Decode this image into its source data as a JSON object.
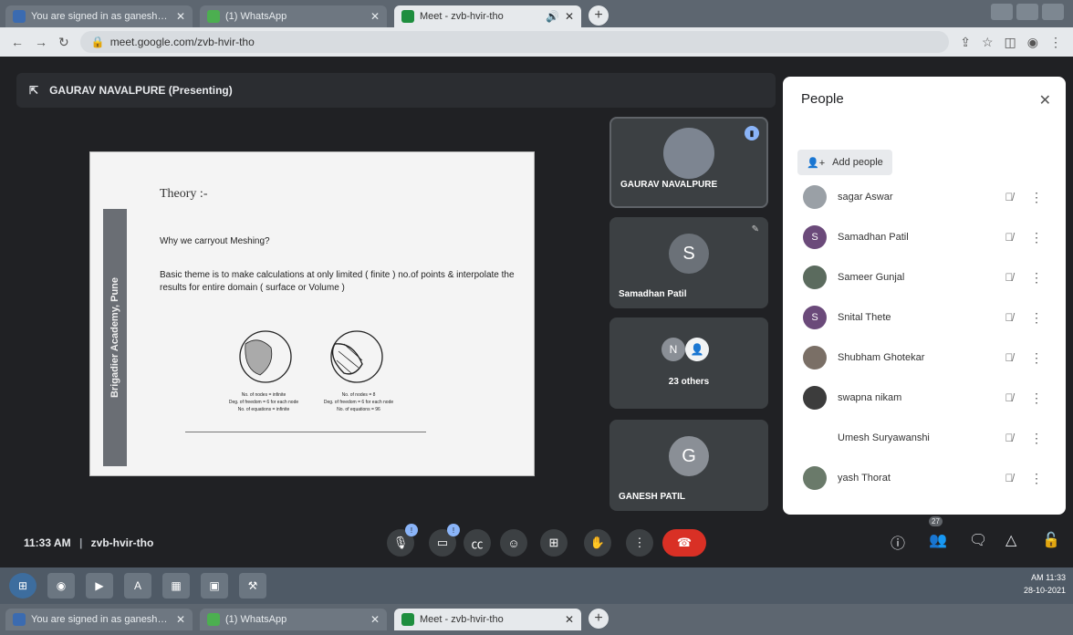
{
  "browser": {
    "tabs": [
      {
        "title": "You are signed in as ganesh_patil"
      },
      {
        "title": "(1) WhatsApp"
      },
      {
        "title": "Meet - zvb-hvir-tho"
      }
    ],
    "url": "meet.google.com/zvb-hvir-tho"
  },
  "meet": {
    "presenter_label": "GAURAV NAVALPURE (Presenting)",
    "time": "11:33 AM",
    "separator": "|",
    "meeting_code": "zvb-hvir-tho",
    "participant_count": "27"
  },
  "slide": {
    "band_text": "Brigadier Academy, Pune",
    "title": "Theory :-",
    "question": "Why we carryout Meshing?",
    "paragraph": "Basic theme is to make calculations at only limited ( finite ) no.of points & interpolate the results for entire domain ( surface or Volume )",
    "left_caption": [
      "No. of nodes = infinite",
      "Deg. of freedom = 6 for each node",
      "No. of equations = infinite"
    ],
    "right_caption": [
      "No. of nodes = 8",
      "Deg. of freedom = 6 for each node",
      "No. of equations = 96"
    ]
  },
  "tiles": [
    {
      "name": "GAURAV NAVALPURE"
    },
    {
      "name": "Samadhan Patil",
      "initial": "S"
    },
    {
      "name": "23 others",
      "initial": "N"
    },
    {
      "name": "GANESH PATIL",
      "initial": "G"
    }
  ],
  "people": {
    "title": "People",
    "add_label": "Add people",
    "list": [
      {
        "name": "sagar Aswar",
        "initial": ""
      },
      {
        "name": "Samadhan Patil",
        "initial": "S"
      },
      {
        "name": "Sameer Gunjal",
        "initial": ""
      },
      {
        "name": "Snital Thete",
        "initial": "S"
      },
      {
        "name": "Shubham Ghotekar",
        "initial": ""
      },
      {
        "name": "swapna nikam",
        "initial": ""
      },
      {
        "name": "Umesh Suryawanshi",
        "initial": ""
      },
      {
        "name": "yash Thorat",
        "initial": ""
      }
    ]
  },
  "taskbar": {
    "clock_time": "AM 11:33",
    "clock_date": "28-10-2021"
  },
  "colors": {
    "meet_bg": "#202124",
    "panel_bg": "#ffffff",
    "end_call": "#d93025",
    "accent": "#8ab4f8"
  }
}
